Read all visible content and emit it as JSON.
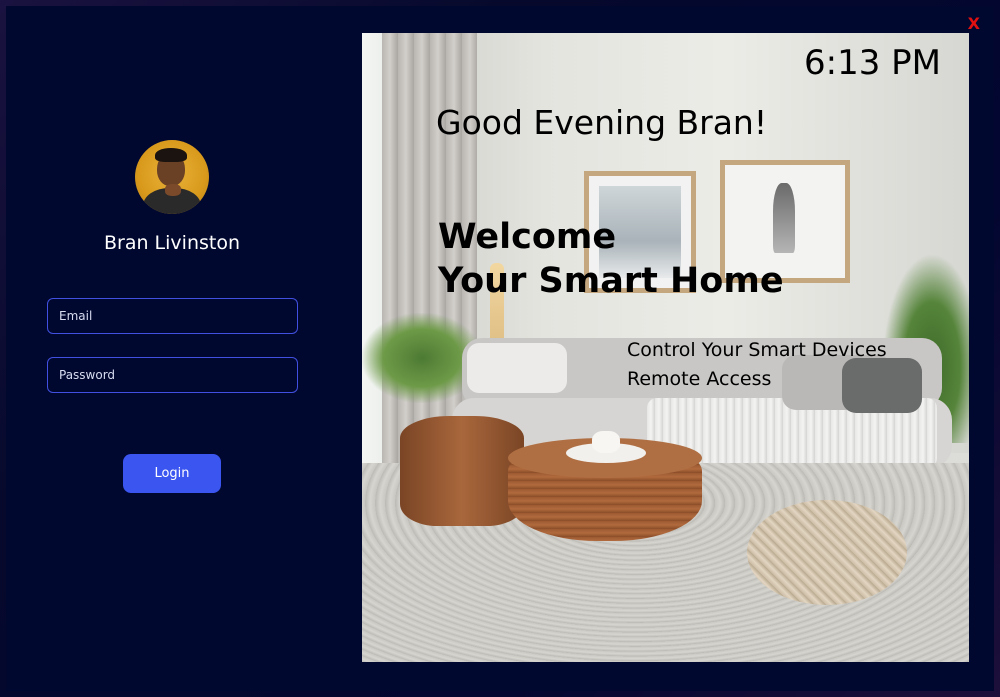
{
  "window": {
    "close_label": "X"
  },
  "login_panel": {
    "user_name": "Bran Livinston",
    "email_placeholder": "Email",
    "email_value": "",
    "password_placeholder": "Password",
    "password_value": "",
    "login_label": "Login"
  },
  "hero": {
    "clock": "6:13 PM",
    "greeting": "Good Evening Bran!",
    "welcome_line1": "Welcome",
    "welcome_line2": "Your Smart Home",
    "feature1": "Control Your Smart Devices",
    "feature2": "Remote Access"
  },
  "colors": {
    "background": "#000830",
    "accent": "#3b55f0",
    "field_border": "#4150e0",
    "close": "#e01010"
  },
  "icons": {
    "close": "close-icon",
    "avatar": "user-avatar"
  }
}
